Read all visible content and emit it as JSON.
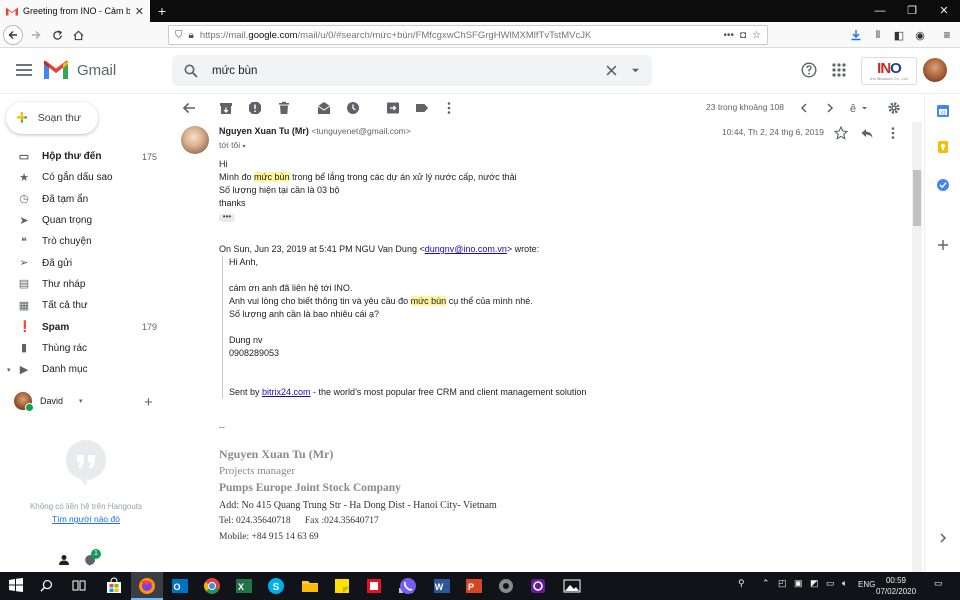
{
  "browser": {
    "tab_title": "Greeting from INO - Cảm biến",
    "tab_close": "✕",
    "new_tab": "+",
    "url": "https://mail.google.com/mail/u/0/#search/mức+bùn/FMfcgxwChSFGrgHWlMXMlfTvTstMVcJK",
    "url_domain_prefix": "https://mail.",
    "url_domain": "google.com",
    "url_path": "/mail/u/0/#search/mức+bùn/FMfcgxwChSFGrgHWlMXMlfTvTstMVcJK",
    "url_more": "•••"
  },
  "gmail": {
    "logo_text": "Gmail",
    "search_query": "mức bùn",
    "org_logo": {
      "main": "INO",
      "sub": "Ino Measure Co., Ltd"
    },
    "compose_label": "Soạn thư"
  },
  "sidebar": {
    "items": [
      {
        "label": "Hộp thư đến",
        "count": "175",
        "bold": true,
        "icon": "inbox-icon"
      },
      {
        "label": "Có gắn dấu sao",
        "count": "",
        "bold": false,
        "icon": "star-icon"
      },
      {
        "label": "Đã tạm ẩn",
        "count": "",
        "bold": false,
        "icon": "snooze-icon"
      },
      {
        "label": "Quan trọng",
        "count": "",
        "bold": false,
        "icon": "important-icon"
      },
      {
        "label": "Trò chuyện",
        "count": "",
        "bold": false,
        "icon": "chat-icon"
      },
      {
        "label": "Đã gửi",
        "count": "",
        "bold": false,
        "icon": "send-icon"
      },
      {
        "label": "Thư nháp",
        "count": "",
        "bold": false,
        "icon": "draft-icon"
      },
      {
        "label": "Tất cả thư",
        "count": "",
        "bold": false,
        "icon": "all-mail-icon"
      },
      {
        "label": "Spam",
        "count": "179",
        "bold": true,
        "icon": "spam-icon"
      },
      {
        "label": "Thùng rác",
        "count": "",
        "bold": false,
        "icon": "trash-icon"
      },
      {
        "label": "Danh mục",
        "count": "",
        "bold": false,
        "icon": "label-icon"
      }
    ],
    "hangouts_user": "David",
    "hangouts_empty": "Không có liên hệ trên Hangouts",
    "hangouts_find": "Tìm người nào đó",
    "hangouts_badge": "1"
  },
  "toolbar": {
    "page_count": "23 trong khoảng 108"
  },
  "message": {
    "sender_name": "Nguyen Xuan Tu (Mr)",
    "sender_email": "<tunguyenet@gmail.com>",
    "to": "tới tôi",
    "date": "10:44, Th 2, 24 thg 6, 2019",
    "greeting": "Hi",
    "line1_pre": "Mình đo ",
    "line1_hl": "mức bùn",
    "line1_post": " trong bể lắng trong các dự án xử lý nước cấp, nước thải",
    "line2": "Số lượng hiện tại cần là 03 bộ",
    "line3": "thanks",
    "ellipsis": "•••",
    "quote_head_pre": "On Sun, Jun 23, 2019 at 5:41 PM NGU Van Dung <",
    "quote_head_link": "dungnv@ino.com.vn",
    "quote_head_post": "> wrote:",
    "q_hi": "Hi Anh,",
    "q_l1": "cám ơn anh đã liên hệ tới INO.",
    "q_l2_pre": "Anh vui lòng cho biết thông tin và yêu cầu đo ",
    "q_l2_hl": "mức bùn",
    "q_l2_post": " cụ thể của mình nhé.",
    "q_l3": "Số lượng anh cần là bao nhiêu cái ạ?",
    "q_name": "Dung nv",
    "q_phone": "0908289053",
    "q_sent_pre": "Sent by ",
    "q_sent_link": "bitrix24.com",
    "q_sent_post": " - the world's most popular free CRM and client management solution",
    "sig_dash": "--",
    "sig_name": "Nguyen Xuan Tu (Mr)",
    "sig_title": "Projects manager",
    "sig_company": "Pumps Europe Joint Stock Company",
    "sig_address": "Add: No 415 Quang Trung Str - Ha Dong Dist - Hanoi City- Vietnam",
    "sig_tel": "Tel: 024.35640718      Fax :024.35640717",
    "sig_mobile": "Mobile: +84 915 14 63 69"
  },
  "taskbar": {
    "lang": "ENG",
    "time": "00:59",
    "date": "07/02/2020"
  }
}
